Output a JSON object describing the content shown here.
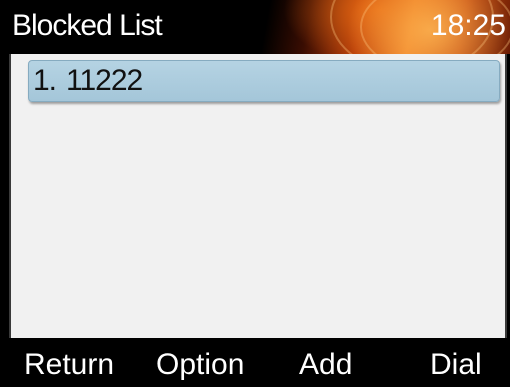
{
  "header": {
    "title": "Blocked List",
    "time": "18:25"
  },
  "blocked_list": {
    "items": [
      {
        "index": "1.",
        "number": "11222",
        "selected": true
      }
    ]
  },
  "softkeys": {
    "return_label": "Return",
    "option_label": "Option",
    "add_label": "Add",
    "dial_label": "Dial"
  },
  "colors": {
    "title_bar_accent": "#ef7d24",
    "selection": "#b5d3e3",
    "content_background": "#f1f1f1"
  }
}
